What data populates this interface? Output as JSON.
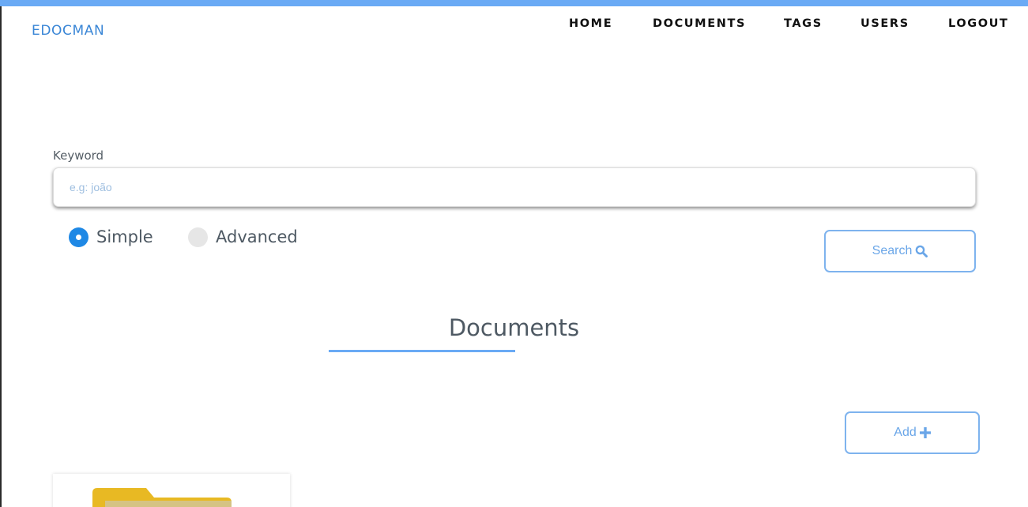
{
  "header": {
    "brand": "EDOCMAN",
    "nav": [
      "HOME",
      "DOCUMENTS",
      "TAGS",
      "USERS",
      "LOGOUT"
    ]
  },
  "search": {
    "label": "Keyword",
    "placeholder": "e.g: joão",
    "value": "",
    "modes": [
      "Simple",
      "Advanced"
    ],
    "selected_mode": "Simple",
    "button_label": "Search"
  },
  "documents": {
    "title": "Documents",
    "add_label": "Add"
  },
  "colors": {
    "accent": "#6aaaf5",
    "radio_selected": "#1e88e5",
    "folder": "#e8b923"
  },
  "icons": [
    "search-icon",
    "plus-icon",
    "folder-icon"
  ]
}
